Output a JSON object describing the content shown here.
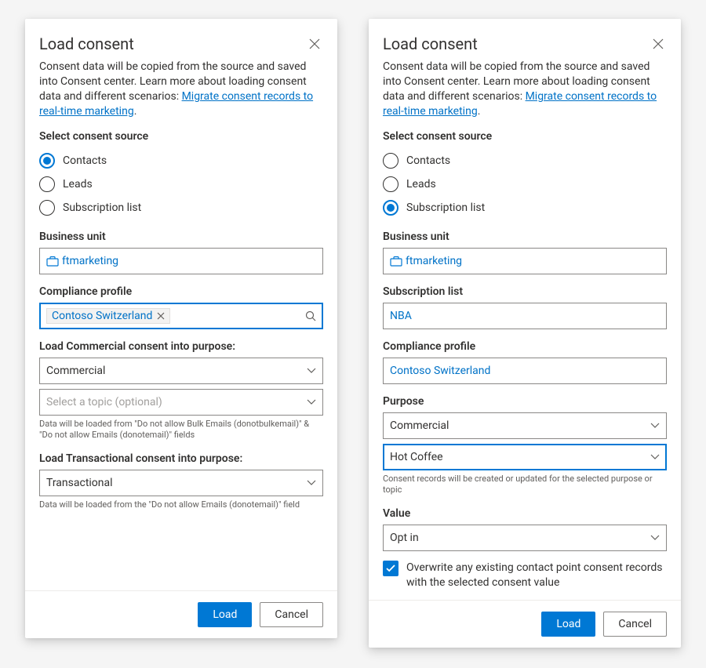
{
  "common": {
    "title": "Load consent",
    "intro_prefix": "Consent data will be copied from the source and saved into Consent center. Learn more about loading consent data and different scenarios: ",
    "intro_link": "Migrate consent records to real-time marketing",
    "intro_suffix": ".",
    "source_heading": "Select consent source",
    "radio_contacts": "Contacts",
    "radio_leads": "Leads",
    "radio_sublist": "Subscription list",
    "bu_label": "Business unit",
    "bu_value": "ftmarketing",
    "compliance_label": "Compliance profile",
    "compliance_value": "Contoso Switzerland",
    "load_button": "Load",
    "cancel_button": "Cancel"
  },
  "left": {
    "selected_source": "Contacts",
    "commercial_heading": "Load Commercial consent into purpose:",
    "commercial_value": "Commercial",
    "topic_placeholder": "Select a topic (optional)",
    "commercial_helper": "Data will be loaded from \"Do not allow Bulk Emails (donotbulkemail)\" & \"Do not allow Emails (donotemail)\" fields",
    "transactional_heading": "Load Transactional consent into purpose:",
    "transactional_value": "Transactional",
    "transactional_helper": "Data will be loaded from the \"Do not allow Emails (donotemail)\" field"
  },
  "right": {
    "selected_source": "Subscription list",
    "sublist_label": "Subscription list",
    "sublist_value": "NBA",
    "purpose_label": "Purpose",
    "purpose_value": "Commercial",
    "topic_value": "Hot Coffee",
    "purpose_helper": "Consent records will be created or updated for the selected purpose or topic",
    "value_label": "Value",
    "value_value": "Opt in",
    "overwrite_check": "Overwrite any existing contact point consent records with the selected consent value"
  }
}
